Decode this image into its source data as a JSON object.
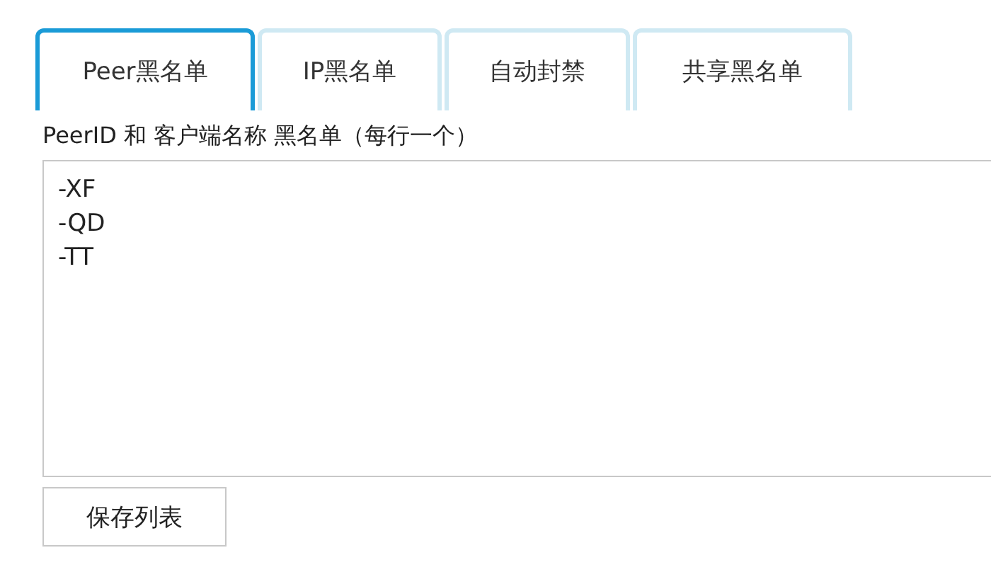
{
  "tabs": [
    {
      "label": "Peer黑名单",
      "selected": true
    },
    {
      "label": "IP黑名单",
      "selected": false
    },
    {
      "label": "自动封禁",
      "selected": false
    },
    {
      "label": "共享黑名单",
      "selected": false
    }
  ],
  "list_label": "PeerID 和 客户端名称 黑名单（每行一个）",
  "list_lines": [
    "-XF",
    "-QD",
    "-TT"
  ],
  "save_button": "保存列表"
}
